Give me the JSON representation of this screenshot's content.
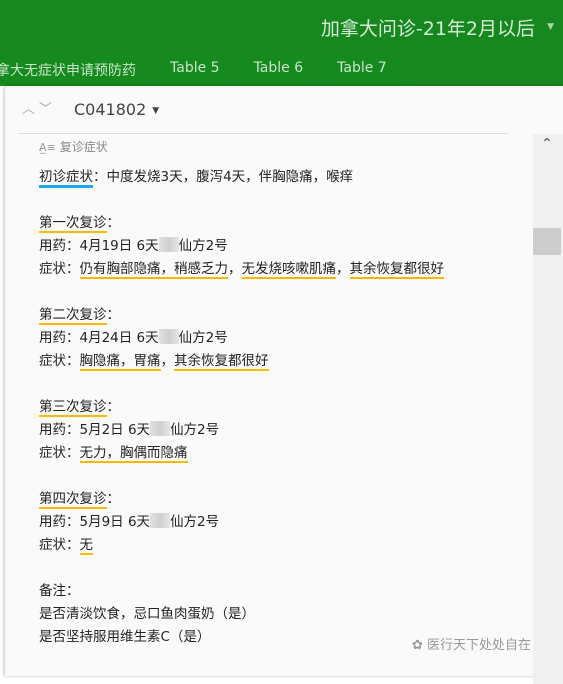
{
  "header": {
    "title": "加拿大问诊-21年2月以后"
  },
  "tabs": [
    "拿大无症状申请预防药",
    "Table 5",
    "Table 6",
    "Table 7"
  ],
  "record": {
    "id": "C041802"
  },
  "field": {
    "label": "复诊症状"
  },
  "content": {
    "initial_label": "初诊症状",
    "initial_text": "：中度发烧3天，腹泻4天，伴胸隐痛，喉痒",
    "visits": [
      {
        "title": "第一次复诊",
        "med_prefix": "用药：4月19日 6天",
        "med_suffix": "仙方2号",
        "sym_prefix": "症状：",
        "symptoms": [
          "仍有胸部隐痛，稍感乏力",
          "无发烧咳嗽肌痛",
          "其余恢复都很好"
        ]
      },
      {
        "title": "第二次复诊",
        "med_prefix": "用药：4月24日 6天",
        "med_suffix": "仙方2号",
        "sym_prefix": "症状：",
        "symptoms": [
          "胸隐痛，胃痛",
          "其余恢复都很好"
        ]
      },
      {
        "title": "第三次复诊",
        "med_prefix": "用药：5月2日 6天",
        "med_suffix": "仙方2号",
        "sym_prefix": "症状：",
        "symptoms": [
          "无力，胸偶而隐痛"
        ]
      },
      {
        "title": "第四次复诊",
        "med_prefix": "用药：5月9日 6天",
        "med_suffix": "仙方2号",
        "sym_prefix": "症状：",
        "symptoms": [
          "无"
        ]
      }
    ],
    "notes_label": "备注：",
    "notes": [
      "是否清淡饮食，忌口鱼肉蛋奶（是）",
      "是否坚持服用维生素C（是）"
    ]
  },
  "watermark": "医行天下处处自在",
  "colors": {
    "header": "#17871f",
    "underline": "#f7bb00",
    "underline_initial": "#1ea8ec"
  }
}
